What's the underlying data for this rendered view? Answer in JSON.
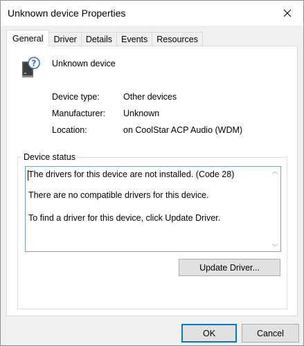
{
  "window": {
    "title": "Unknown device Properties"
  },
  "tabs": [
    {
      "label": "General"
    },
    {
      "label": "Driver"
    },
    {
      "label": "Details"
    },
    {
      "label": "Events"
    },
    {
      "label": "Resources"
    }
  ],
  "general": {
    "device_name": "Unknown device",
    "device_icon": "unknown-device-icon",
    "properties": [
      {
        "label": "Device type:",
        "value": "Other devices"
      },
      {
        "label": "Manufacturer:",
        "value": "Unknown"
      },
      {
        "label": "Location:",
        "value": "on CoolStar ACP Audio (WDM)"
      }
    ],
    "status_group_title": "Device status",
    "status_lines": [
      "The drivers for this device are not installed. (Code 28)",
      "There are no compatible drivers for this device.",
      "To find a driver for this device, click Update Driver."
    ],
    "update_driver_label": "Update Driver..."
  },
  "footer": {
    "ok_label": "OK",
    "cancel_label": "Cancel"
  },
  "colors": {
    "focus_border": "#0078d7",
    "status_box_border": "#7ba2d4"
  }
}
